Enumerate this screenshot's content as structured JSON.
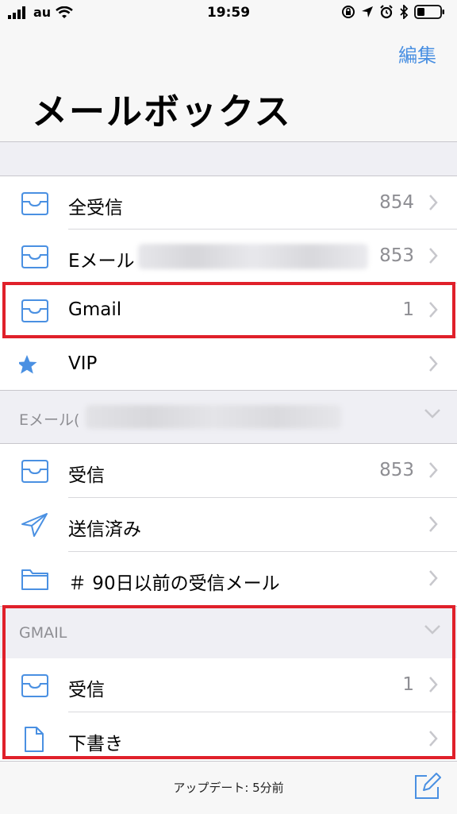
{
  "status_bar": {
    "carrier": "au",
    "time": "19:59"
  },
  "header": {
    "edit_label": "編集",
    "title": "メールボックス"
  },
  "mailboxes": [
    {
      "label": "全受信",
      "count": "854",
      "icon": "inbox-tray-icon"
    },
    {
      "label": "Eメール",
      "count": "853",
      "icon": "inbox-tray-icon",
      "redacted": true
    },
    {
      "label": "Gmail",
      "count": "1",
      "icon": "inbox-tray-icon",
      "highlighted": true
    },
    {
      "label": "VIP",
      "count": "",
      "icon": "star-icon"
    }
  ],
  "account_email": {
    "header_label": "Eメール(",
    "items": [
      {
        "label": "受信",
        "count": "853",
        "icon": "inbox-tray-icon"
      },
      {
        "label": "送信済み",
        "count": "",
        "icon": "paper-plane-icon"
      },
      {
        "label": "＃ 90日以前の受信メール",
        "count": "",
        "icon": "folder-icon"
      }
    ]
  },
  "account_gmail": {
    "header_label": "GMAIL",
    "items": [
      {
        "label": "受信",
        "count": "1",
        "icon": "inbox-tray-icon"
      },
      {
        "label": "下書き",
        "count": "",
        "icon": "document-icon"
      }
    ]
  },
  "toolbar": {
    "update_text": "アップデート: 5分前"
  },
  "colors": {
    "accent": "#4a90e2",
    "highlight": "#e0202a",
    "secondary_text": "#8e8e93"
  }
}
